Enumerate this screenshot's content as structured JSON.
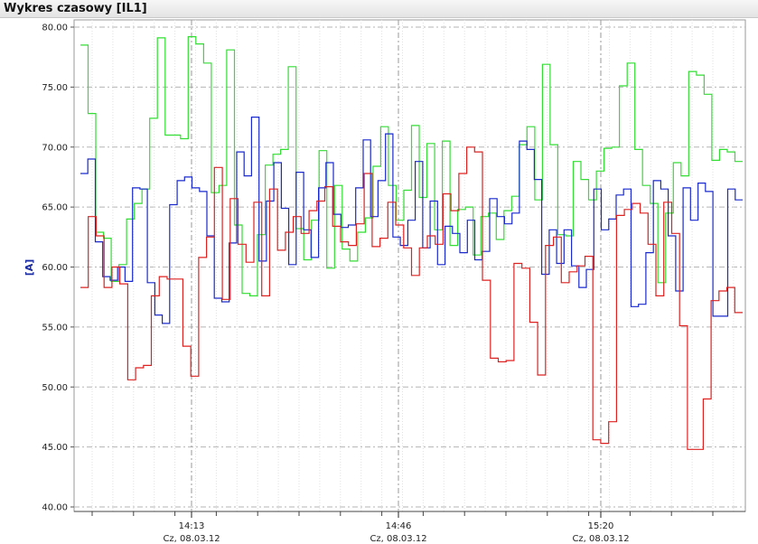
{
  "window": {
    "title": "Wykres czasowy [IL1]"
  },
  "chart_data": {
    "type": "line",
    "step": true,
    "ylabel": "[A]",
    "ylim": [
      40,
      80
    ],
    "yticks": [
      "80.00",
      "75.00",
      "70.00",
      "65.00",
      "60.00",
      "55.00",
      "50.00",
      "45.00",
      "40.00"
    ],
    "xticks": [
      {
        "time": "14:13",
        "date": "Cz, 08.03.12"
      },
      {
        "time": "14:46",
        "date": "Cz, 08.03.12"
      },
      {
        "time": "15:20",
        "date": "Cz, 08.03.12"
      }
    ],
    "grid": true,
    "colors": {
      "green": "#33dd33",
      "blue": "#1a2acc",
      "red": "#dd2222"
    },
    "series": [
      {
        "color": "green",
        "values": [
          78.5,
          72.8,
          62.9,
          62.4,
          58.8,
          60.2,
          64.0,
          65.3,
          66.5,
          72.4,
          79.1,
          71.0,
          71.0,
          70.7,
          79.2,
          78.6,
          77.0,
          66.2,
          66.8,
          78.1,
          63.5,
          57.8,
          57.6,
          62.7,
          68.5,
          69.4,
          69.8,
          76.7,
          63.2,
          60.6,
          63.9,
          69.7,
          59.9,
          66.8,
          61.5,
          60.5,
          62.9,
          64.1,
          68.4,
          71.7,
          66.8,
          63.9,
          66.4,
          71.8,
          65.8,
          70.3,
          63.1,
          70.5,
          61.8,
          64.8,
          65.0,
          61.0,
          64.2,
          64.5,
          62.3,
          64.7,
          65.9,
          70.2,
          71.7,
          65.6,
          76.9,
          70.2,
          62.7,
          62.6,
          68.8,
          67.3,
          65.6,
          68.0,
          69.9,
          70.0,
          75.1,
          77.0,
          69.8,
          66.8,
          65.3,
          58.7,
          64.5,
          68.7,
          67.6,
          76.3,
          76.0,
          74.4,
          68.9,
          69.8,
          69.6,
          68.8
        ]
      },
      {
        "color": "blue",
        "values": [
          67.8,
          69.0,
          62.1,
          59.2,
          58.9,
          60.0,
          58.8,
          66.6,
          66.5,
          58.7,
          56.0,
          55.3,
          65.2,
          67.2,
          67.5,
          66.6,
          66.3,
          62.6,
          57.4,
          57.1,
          62.0,
          69.6,
          67.6,
          72.5,
          60.5,
          65.5,
          68.7,
          64.9,
          60.2,
          67.9,
          63.1,
          60.8,
          66.6,
          68.7,
          64.4,
          63.3,
          63.5,
          66.6,
          70.6,
          64.2,
          67.2,
          71.1,
          62.5,
          61.8,
          63.9,
          68.8,
          61.6,
          65.5,
          60.2,
          63.4,
          62.8,
          61.2,
          63.9,
          60.6,
          61.3,
          65.7,
          64.2,
          63.6,
          64.5,
          70.5,
          69.8,
          67.3,
          59.4,
          63.1,
          60.3,
          63.1,
          60.1,
          58.3,
          59.8,
          66.5,
          63.1,
          64.0,
          66.0,
          66.5,
          56.7,
          56.9,
          61.2,
          67.2,
          66.5,
          62.6,
          58.0,
          66.6,
          63.9,
          67.0,
          66.3,
          55.9,
          55.9,
          66.5,
          65.6
        ]
      },
      {
        "color": "red",
        "values": [
          58.3,
          64.2,
          62.6,
          58.3,
          60.0,
          58.6,
          50.6,
          51.6,
          51.8,
          57.6,
          59.2,
          59.0,
          59.0,
          53.4,
          50.9,
          60.8,
          62.5,
          68.3,
          57.3,
          65.7,
          61.9,
          60.4,
          65.4,
          57.6,
          66.5,
          61.4,
          62.9,
          64.2,
          62.8,
          64.7,
          65.5,
          66.7,
          63.4,
          62.1,
          61.8,
          63.6,
          67.8,
          61.7,
          62.4,
          65.4,
          63.5,
          61.6,
          59.3,
          61.6,
          62.6,
          61.9,
          66.1,
          64.7,
          67.8,
          70.0,
          69.6,
          58.9,
          52.4,
          52.1,
          52.2,
          60.3,
          59.9,
          55.4,
          51.0,
          61.8,
          62.5,
          58.7,
          59.6,
          60.1,
          60.9,
          45.6,
          45.3,
          47.1,
          64.3,
          64.8,
          65.3,
          64.5,
          61.9,
          57.6,
          65.4,
          62.8,
          55.1,
          44.8,
          44.8,
          49.0,
          57.2,
          58.0,
          58.3,
          56.2
        ]
      }
    ]
  }
}
